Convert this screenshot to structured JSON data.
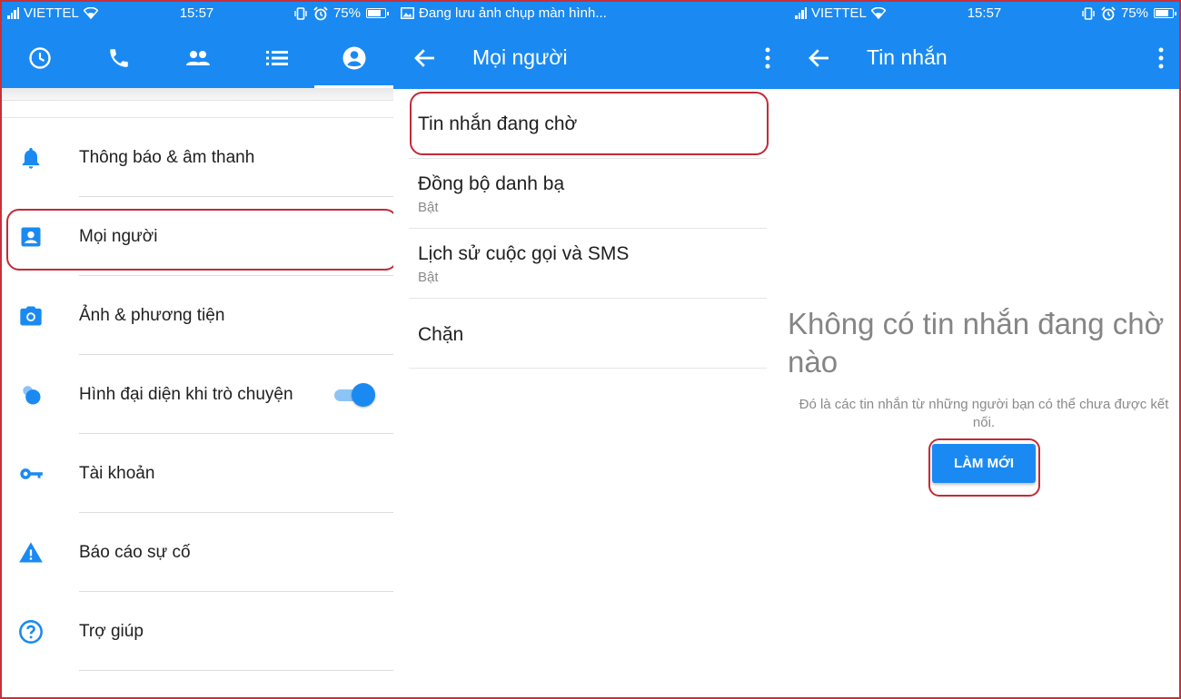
{
  "colors": {
    "accent": "#1a8af2",
    "highlight": "#c22b36",
    "toggle_track": "#8cc4f7"
  },
  "status_bars": [
    {
      "carrier": "VIETTEL",
      "time": "15:57",
      "battery": "75%",
      "icons": [
        "signal-icon",
        "wifi-icon",
        "vibrate-icon",
        "alarm-icon",
        "battery-icon"
      ]
    },
    {
      "notification": "Đang lưu ảnh chụp màn hình...",
      "icons": [
        "image-icon"
      ]
    },
    {
      "carrier": "VIETTEL",
      "time": "15:57",
      "battery": "75%",
      "icons": [
        "signal-icon",
        "wifi-icon",
        "vibrate-icon",
        "alarm-icon",
        "battery-icon"
      ]
    }
  ],
  "settings_screen": {
    "tabs": [
      {
        "icon": "clock-icon",
        "active": false
      },
      {
        "icon": "phone-icon",
        "active": false
      },
      {
        "icon": "people-icon",
        "active": false
      },
      {
        "icon": "list-icon",
        "active": false
      },
      {
        "icon": "profile-icon",
        "active": true
      }
    ],
    "items": [
      {
        "label": "Thông báo & âm thanh",
        "icon": "bell-icon"
      },
      {
        "label": "Mọi người",
        "icon": "contact-card-icon",
        "highlighted": true
      },
      {
        "label": "Ảnh & phương tiện",
        "icon": "camera-icon"
      },
      {
        "label": "Hình đại diện khi trò chuyện",
        "icon": "chat-heads-icon",
        "toggle_on": true
      },
      {
        "label": "Tài khoản",
        "icon": "key-icon"
      },
      {
        "label": "Báo cáo sự cố",
        "icon": "warning-icon"
      },
      {
        "label": "Trợ giúp",
        "icon": "help-icon"
      }
    ]
  },
  "people_screen": {
    "title": "Mọi người",
    "items": [
      {
        "label": "Tin nhắn đang chờ",
        "highlighted": true
      },
      {
        "label": "Đồng bộ danh bạ",
        "sub": "Bật"
      },
      {
        "label": "Lịch sử cuộc gọi và SMS",
        "sub": "Bật"
      },
      {
        "label": "Chặn"
      }
    ]
  },
  "messages_screen": {
    "title": "Tin nhắn",
    "empty_title": "Không có tin nhắn đang chờ nào",
    "empty_desc": "Đó là các tin nhắn từ những người bạn có thể chưa được kết nối.",
    "refresh_button": "LÀM MỚI"
  }
}
